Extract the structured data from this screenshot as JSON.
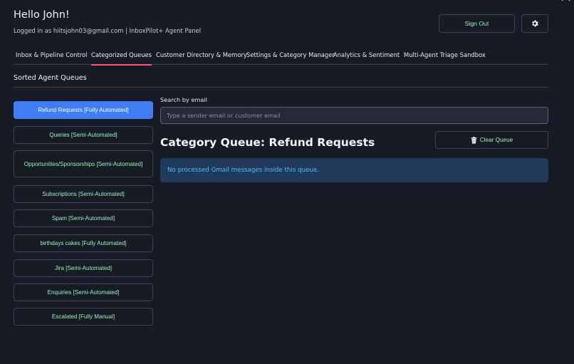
{
  "header": {
    "greeting": "Hello John!",
    "subline": "Logged in as hiitsjohn03@gmail.com | InboxPilot+ Agent Panel",
    "sign_out_label": "Sign Out",
    "settings_icon": "gear-icon"
  },
  "tabs": [
    {
      "label": "Inbox & Pipeline Control",
      "active": false
    },
    {
      "label": "Categorized Queues",
      "active": true
    },
    {
      "label": "Customer Directory & Memory",
      "active": false
    },
    {
      "label": "Settings & Category Manager",
      "active": false
    },
    {
      "label": "Analytics & Sentiment",
      "active": false
    },
    {
      "label": "Multi-Agent Triage Sandbox",
      "active": false
    }
  ],
  "section": {
    "title": "Sorted Agent Queues"
  },
  "queues": [
    {
      "label": "Refund Requests [Fully Automated]",
      "active": true
    },
    {
      "label": "Queries [Semi-Automated]",
      "active": false
    },
    {
      "label": "Opportunities/Sponsorships [Semi-Automated]",
      "active": false
    },
    {
      "label": "Subscriptions [Semi-Automated]",
      "active": false
    },
    {
      "label": "Spam [Semi-Automated]",
      "active": false
    },
    {
      "label": "birthdays cakes [Fully Automated]",
      "active": false
    },
    {
      "label": "Jira [Semi-Automated]",
      "active": false
    },
    {
      "label": "Enquiries [Semi-Automated]",
      "active": false
    },
    {
      "label": "Escalated [Fully Manual]",
      "active": false
    }
  ],
  "search": {
    "label": "Search by email",
    "placeholder": "Type a sender email or customer email",
    "value": ""
  },
  "queue_view": {
    "heading": "Category Queue: Refund Requests",
    "clear_label": "Clear Queue",
    "clear_icon": "trash-icon",
    "info_message": "No processed Gmail messages inside this queue."
  },
  "colors": {
    "background": "#161b26",
    "accent_blue": "#3e7df6",
    "button_text_green": "#9ef0b8",
    "active_tab_underline": "#ff5b61",
    "info_text": "#5ab8ff",
    "info_bg": "#1f3a5a"
  }
}
